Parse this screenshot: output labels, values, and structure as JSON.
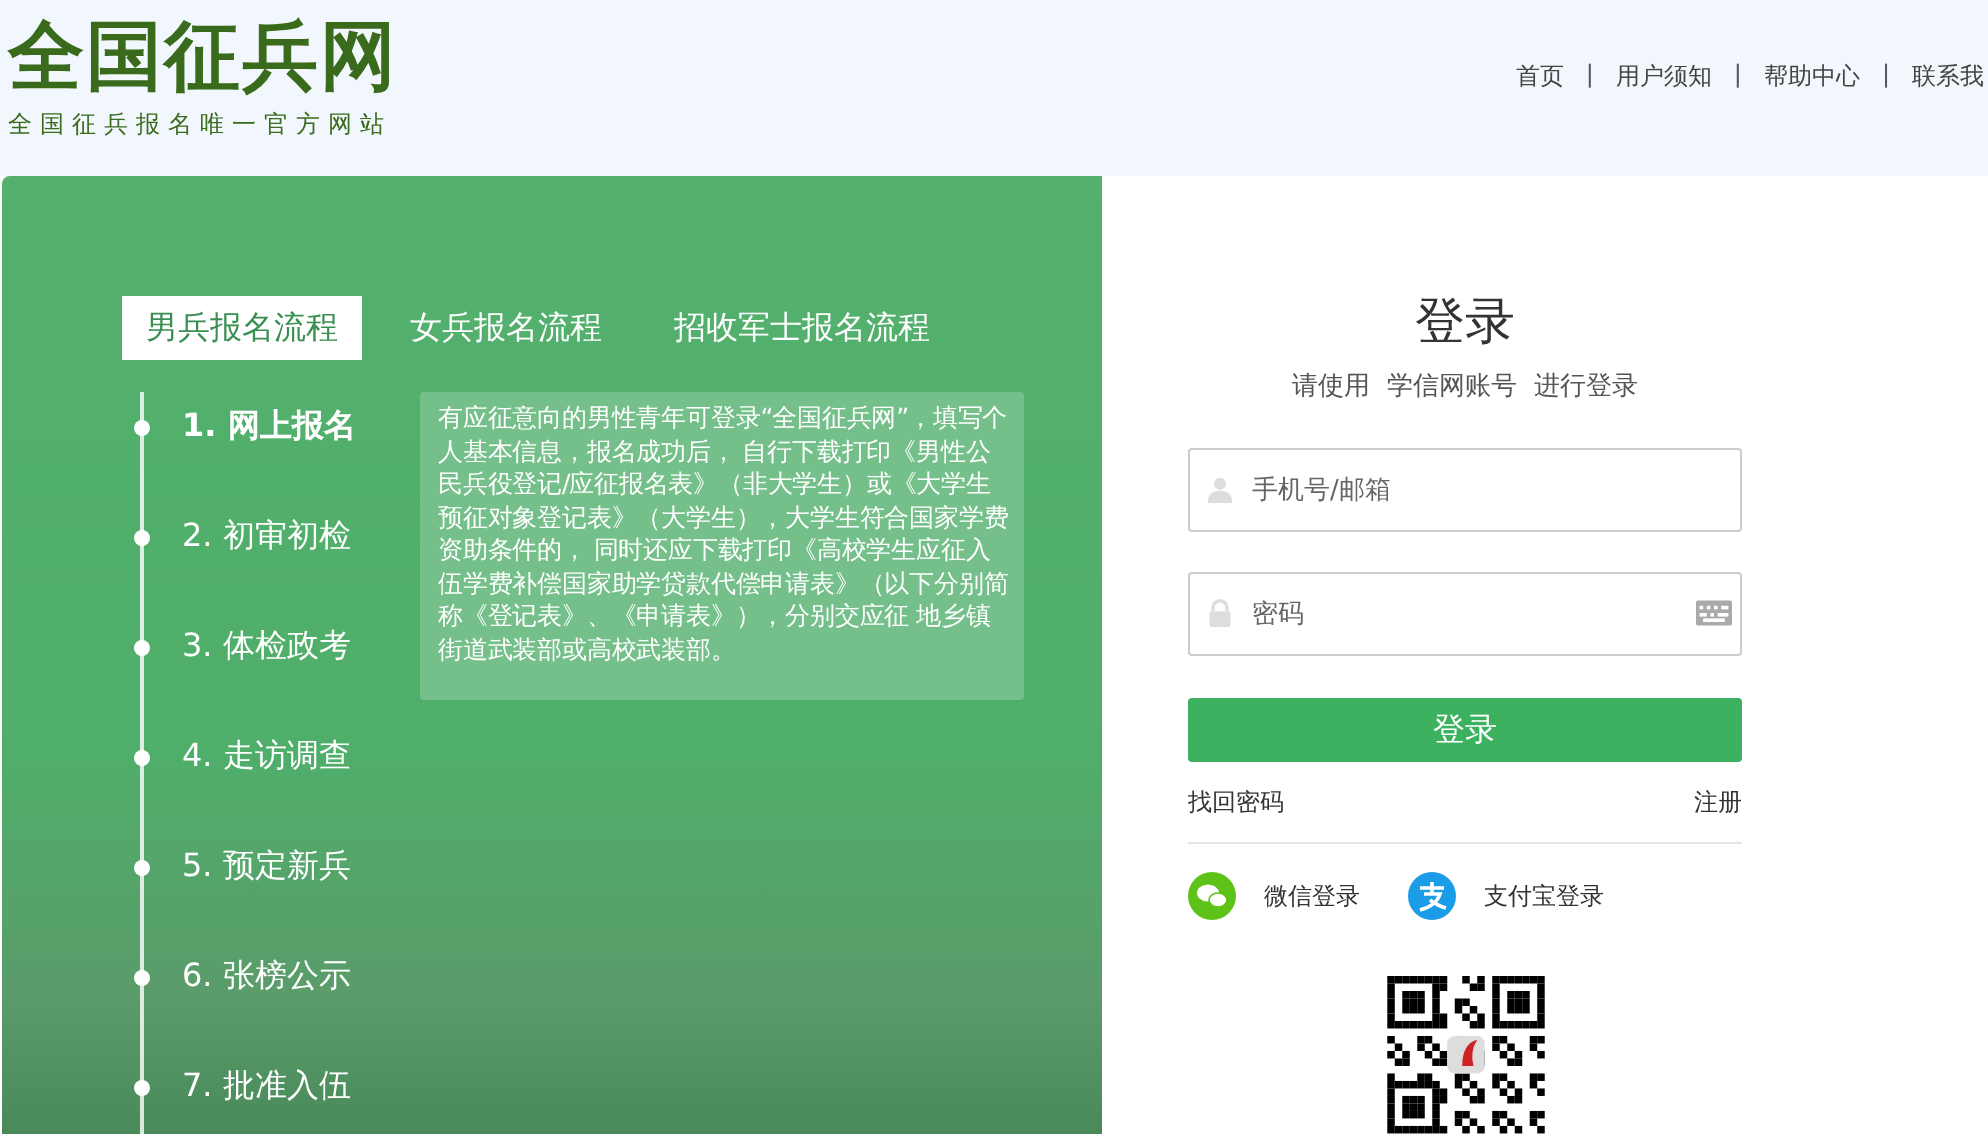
{
  "header": {
    "logo": "全国征兵网",
    "slogan": "全国征兵报名唯一官方网站",
    "nav": [
      "首页",
      "用户须知",
      "帮助中心",
      "联系我"
    ],
    "separator": "|"
  },
  "tabs": [
    {
      "label": "男兵报名流程",
      "selected": true
    },
    {
      "label": "女兵报名流程",
      "selected": false
    },
    {
      "label": "招收军士报名流程",
      "selected": false
    }
  ],
  "steps": [
    {
      "label": "1. 网上报名",
      "selected": true
    },
    {
      "label": "2. 初审初检",
      "selected": false
    },
    {
      "label": "3. 体检政考",
      "selected": false
    },
    {
      "label": "4. 走访调查",
      "selected": false
    },
    {
      "label": "5. 预定新兵",
      "selected": false
    },
    {
      "label": "6. 张榜公示",
      "selected": false
    },
    {
      "label": "7. 批准入伍",
      "selected": false
    }
  ],
  "tooltip": "有应征意向的男性青年可登录“全国征兵网”，填写个人基本信息，报名成功后， 自行下载打印《男性公民兵役登记/应征报名表》（非大学生）或《大学生预征对象登记表》（大学生），大学生符合国家学费资助条件的， 同时还应下载打印《高校学生应征入伍学费补偿国家助学贷款代偿申请表》（以下分别简称《登记表》、《申请表》），分别交应征 地乡镇街道武装部或高校武装部。",
  "login": {
    "title": "登录",
    "subtitle": "请使用  学信网账号  进行登录",
    "username": {
      "placeholder": "手机号/邮箱"
    },
    "password": {
      "placeholder": "密码"
    },
    "submit": "登录",
    "forgot": "找回密码",
    "register": "注册",
    "wechat": "微信登录",
    "alipay": "支付宝登录"
  }
}
